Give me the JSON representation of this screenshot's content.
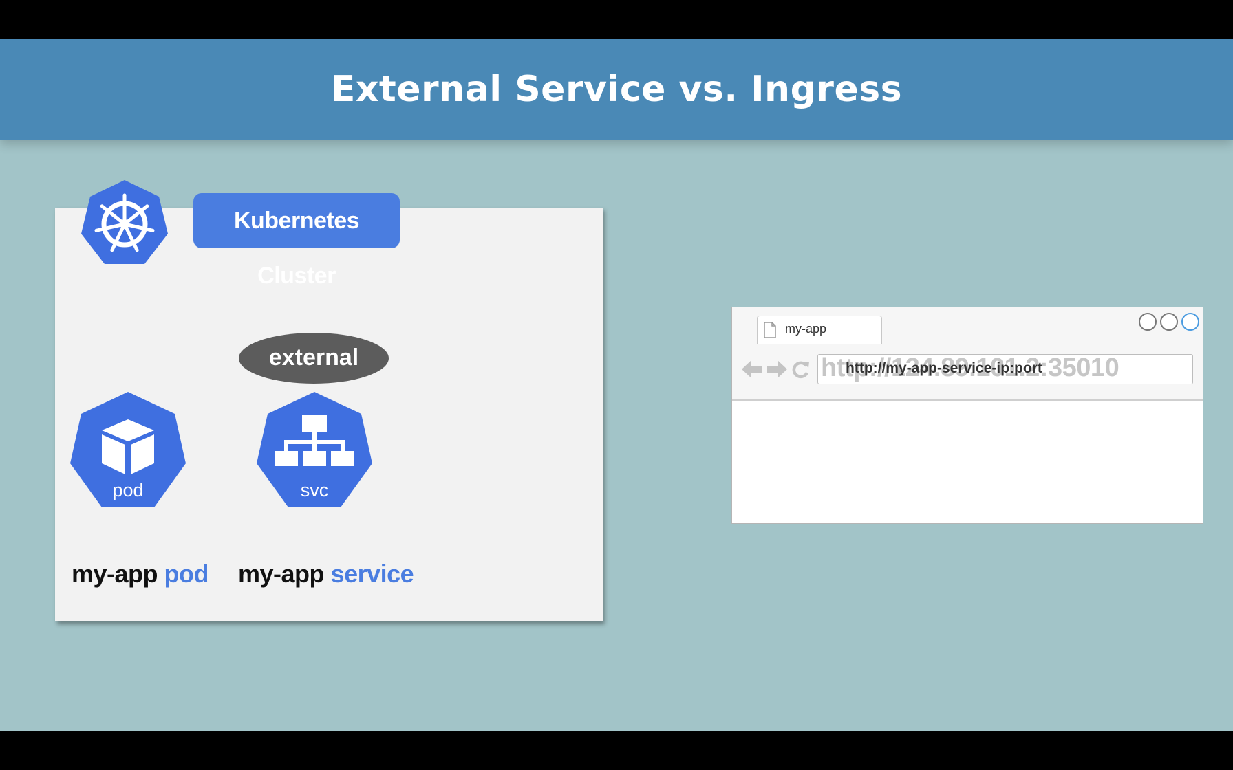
{
  "slide": {
    "title": "External Service vs. Ingress"
  },
  "cluster": {
    "label": "Kubernetes Cluster",
    "icon": "kubernetes-helm-icon"
  },
  "service_type_badge": "external",
  "pod": {
    "icon_label": "pod",
    "caption_name": "my-app",
    "caption_kind": "pod",
    "icon": "pod-cube-icon"
  },
  "service": {
    "icon_label": "svc",
    "caption_name": "my-app",
    "caption_kind": "service",
    "icon": "service-network-icon"
  },
  "browser": {
    "tab_title": "my-app",
    "url_ghost": "http://124.89.101.2:35010",
    "url": "http://my-app-service-ip:port"
  },
  "colors": {
    "header": "#4a89b6",
    "background": "#a2c4c8",
    "kubernetes_blue": "#4a7de0",
    "pill_gray": "#5c5c5c"
  }
}
